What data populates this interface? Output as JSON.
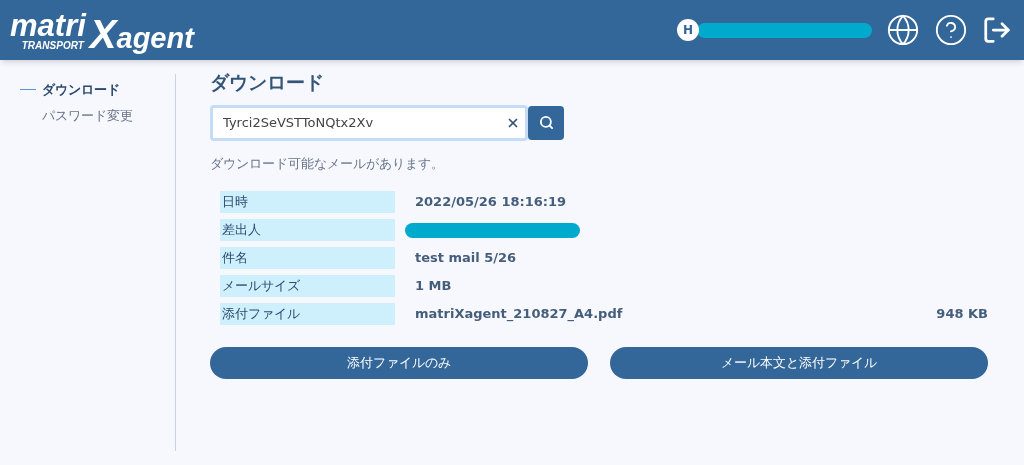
{
  "header": {
    "logo": {
      "word_start": "matri",
      "tagline": "TRANSPORT",
      "mark": "X",
      "word_end": "agent"
    },
    "user": {
      "initial": "H",
      "name_redacted": true
    }
  },
  "sidebar": {
    "items": [
      {
        "label": "ダウンロード",
        "selected": true
      },
      {
        "label": "パスワード変更",
        "selected": false
      }
    ]
  },
  "page_title": "ダウンロード",
  "search": {
    "value": "Tyrci2SeVSTToNQtx2Xv"
  },
  "message": "ダウンロード可能なメールがあります。",
  "details": [
    {
      "label": "日時",
      "value": "2022/05/26 18:16:19"
    },
    {
      "label": "差出人",
      "redacted": true
    },
    {
      "label": "件名",
      "value": "test mail 5/26"
    },
    {
      "label": "メールサイズ",
      "value": "1 MB"
    },
    {
      "label": "添付ファイル",
      "value": "matriXagent_210827_A4.pdf",
      "size": "948 KB"
    }
  ],
  "buttons": [
    "添付ファイルのみ",
    "メール本文と添付ファイル"
  ]
}
